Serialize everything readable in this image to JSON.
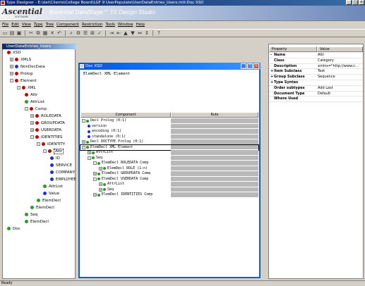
{
  "window": {
    "title": "Type Designer - E:\\dat\\Clients\\College Board\\LGF 9 UserPopulate\\UserDataEntries_Users.mtt:Doc XSD"
  },
  "banner": {
    "logo": "Ascential",
    "logo_sub": "SOFTWARE",
    "title": "Ascential DataStage™ TX Design Studio"
  },
  "menu": [
    "File",
    "Edit",
    "View",
    "Type",
    "Tree",
    "Component",
    "Restriction",
    "Tools",
    "Window",
    "Help"
  ],
  "tree_panel": {
    "title": "UserDataEntries_Users",
    "items": [
      {
        "label": "XSD",
        "color": "#c00000",
        "expander": ""
      },
      {
        "label": "XMLS",
        "color": "#c00000",
        "expander": "+"
      },
      {
        "label": "NonDocData",
        "color": "#1a2fd1",
        "expander": "+"
      },
      {
        "label": "Prolog",
        "color": "#c00000",
        "expander": "+"
      },
      {
        "label": "Element",
        "color": "#c00000",
        "expander": "-"
      },
      {
        "label": "XML",
        "color": "#c00000",
        "expander": "-"
      },
      {
        "label": "Attr",
        "color": "#c00000",
        "expander": ""
      },
      {
        "label": "AttrList",
        "color": "#2a9a2a",
        "expander": ""
      },
      {
        "label": "Comp",
        "color": "#c00000",
        "expander": "-"
      },
      {
        "label": "ROLEDATA",
        "color": "#c00000",
        "expander": "+"
      },
      {
        "label": "GROUPDATA",
        "color": "#c00000",
        "expander": "+"
      },
      {
        "label": "USERDATA",
        "color": "#c00000",
        "expander": "+"
      },
      {
        "label": "IDENTITIES",
        "color": "#c00000",
        "expander": "-"
      },
      {
        "label": "IDENTITY",
        "color": "#c00000",
        "expander": "-"
      },
      {
        "label": "Attr",
        "color": "#c00000",
        "expander": "-"
      },
      {
        "label": "ID",
        "color": "#1a2fd1",
        "expander": ""
      },
      {
        "label": "SERVICE",
        "color": "#1a2fd1",
        "expander": ""
      },
      {
        "label": "COMPANY",
        "color": "#1a2fd1",
        "expander": ""
      },
      {
        "label": "EMPLOYEE",
        "color": "#1a2fd1",
        "expander": ""
      },
      {
        "label": "AttrList",
        "color": "#2a9a2a",
        "expander": ""
      },
      {
        "label": "Value",
        "color": "#1a2fd1",
        "expander": ""
      },
      {
        "label": "ElemDecl",
        "color": "#2a9a2a",
        "expander": ""
      },
      {
        "label": "ElemDecl",
        "color": "#2a9a2a",
        "expander": ""
      },
      {
        "label": "Seq",
        "color": "#2a9a2a",
        "expander": ""
      },
      {
        "label": "ElemDecl",
        "color": "#2a9a2a",
        "expander": ""
      },
      {
        "label": "Doc",
        "color": "#2a9a2a",
        "expander": ""
      }
    ]
  },
  "doc_window": {
    "title": "Doc XSD",
    "description": "ElemDecl XML Element",
    "columns": [
      "Component",
      "Rule"
    ],
    "rows": [
      {
        "text": "Decl Prolog (0:1)",
        "expander": "-",
        "color": "#2a9a2a"
      },
      {
        "text": "version",
        "expander": "",
        "color": "#1a2fd1"
      },
      {
        "text": "encoding (0:1)",
        "expander": "",
        "color": "#1a2fd1"
      },
      {
        "text": "standalone (0:1)",
        "expander": "",
        "color": "#1a2fd1"
      },
      {
        "text": "Decl DOCTYPE Prolog (0:1)",
        "expander": "+",
        "color": "#2a9a2a"
      },
      {
        "text": "ElemDecl XML Element",
        "expander": "-",
        "color": "#2a9a2a"
      },
      {
        "text": "AttrList",
        "expander": "+",
        "color": "#2a9a2a"
      },
      {
        "text": "Seq",
        "expander": "-",
        "color": "#2a9a2a"
      },
      {
        "text": "ElemDecl ROLEDATA Comp",
        "expander": "-",
        "color": "#2a9a2a"
      },
      {
        "text": "ElemDecl ROLE (1:n)",
        "expander": "+",
        "color": "#2a9a2a"
      },
      {
        "text": "ElemDecl GROUPDATA Comp",
        "expander": "+",
        "color": "#2a9a2a"
      },
      {
        "text": "ElemDecl USERDATA Comp",
        "expander": "-",
        "color": "#2a9a2a"
      },
      {
        "text": "AttrList",
        "expander": "+",
        "color": "#2a9a2a"
      },
      {
        "text": "Seq",
        "expander": "+",
        "color": "#2a9a2a"
      },
      {
        "text": "ElemDecl IDENTITIES Comp",
        "expander": "+",
        "color": "#2a9a2a"
      }
    ]
  },
  "properties": {
    "columns": [
      "Property",
      "Value"
    ],
    "rows": [
      {
        "name": "Name",
        "value": "Attr",
        "expander": "-"
      },
      {
        "name": "Class",
        "value": "Category",
        "expander": ""
      },
      {
        "name": "Description",
        "value": "xmlns=\"http://www.c...",
        "expander": ""
      },
      {
        "name": "Item Subclass",
        "value": "Text",
        "expander": "+"
      },
      {
        "name": "Group Subclass",
        "value": "Sequence",
        "expander": "+"
      },
      {
        "name": "Type Syntax",
        "value": "",
        "expander": "+"
      },
      {
        "name": "Order subtypes",
        "value": "Add Last",
        "expander": ""
      },
      {
        "name": "Document Type",
        "value": "Default",
        "expander": ""
      },
      {
        "name": "Where Used",
        "value": "",
        "expander": ""
      }
    ]
  },
  "status": {
    "text": "Ready"
  }
}
